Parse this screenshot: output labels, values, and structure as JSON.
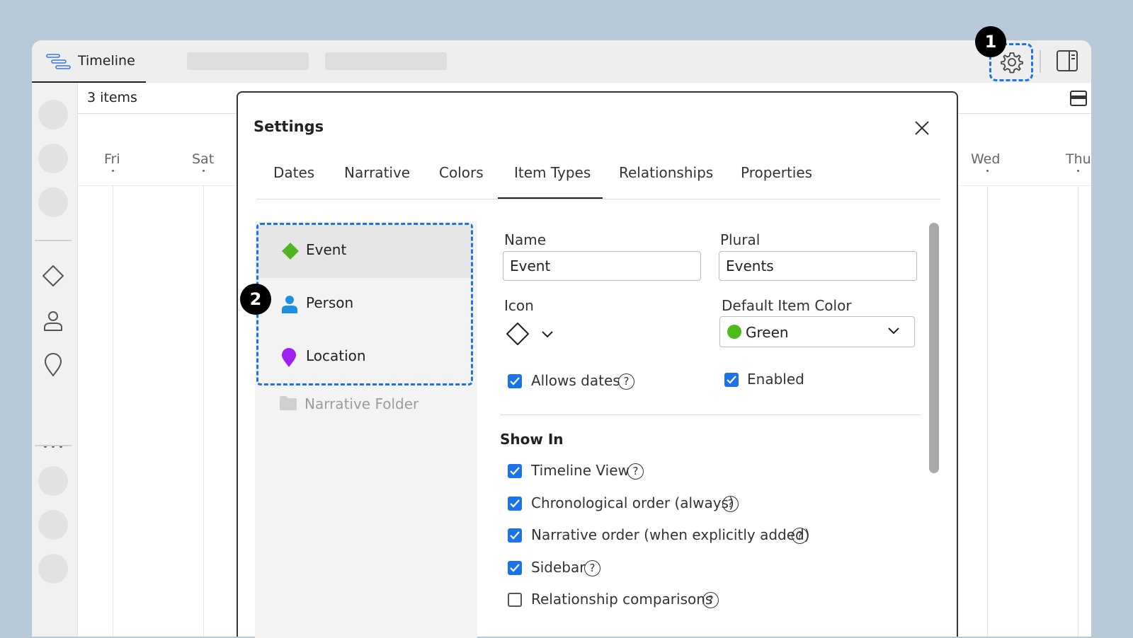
{
  "window": {
    "tab_label": "Timeline",
    "items_count": "3 items",
    "days": [
      "Fri",
      "Sat",
      "Wed",
      "Thu"
    ]
  },
  "callouts": {
    "one": "1",
    "two": "2"
  },
  "modal": {
    "title": "Settings",
    "tabs": [
      "Dates",
      "Narrative",
      "Colors",
      "Item Types",
      "Relationships",
      "Properties"
    ],
    "active_tab": "Item Types",
    "item_types": [
      {
        "label": "Event",
        "icon": "diamond-icon",
        "color": "#52b41e"
      },
      {
        "label": "Person",
        "icon": "person-icon",
        "color": "#1e90e0"
      },
      {
        "label": "Location",
        "icon": "location-pin-icon",
        "color": "#a020f0"
      }
    ],
    "narrative_folder": "Narrative Folder",
    "form": {
      "name_label": "Name",
      "name_value": "Event",
      "plural_label": "Plural",
      "plural_value": "Events",
      "icon_label": "Icon",
      "color_label": "Default Item Color",
      "color_value": "Green",
      "allows_dates": "Allows dates",
      "enabled": "Enabled",
      "help_glyph": "?"
    },
    "show_in": {
      "title": "Show In",
      "options": [
        {
          "label": "Timeline View",
          "checked": true
        },
        {
          "label": "Chronological order (always)",
          "checked": true
        },
        {
          "label": "Narrative order (when explicitly added)",
          "checked": true
        },
        {
          "label": "Sidebar",
          "checked": true
        },
        {
          "label": "Relationship comparisons",
          "checked": false
        }
      ]
    }
  },
  "colors": {
    "accent": "#1a73e8",
    "green": "#4cbb17"
  }
}
